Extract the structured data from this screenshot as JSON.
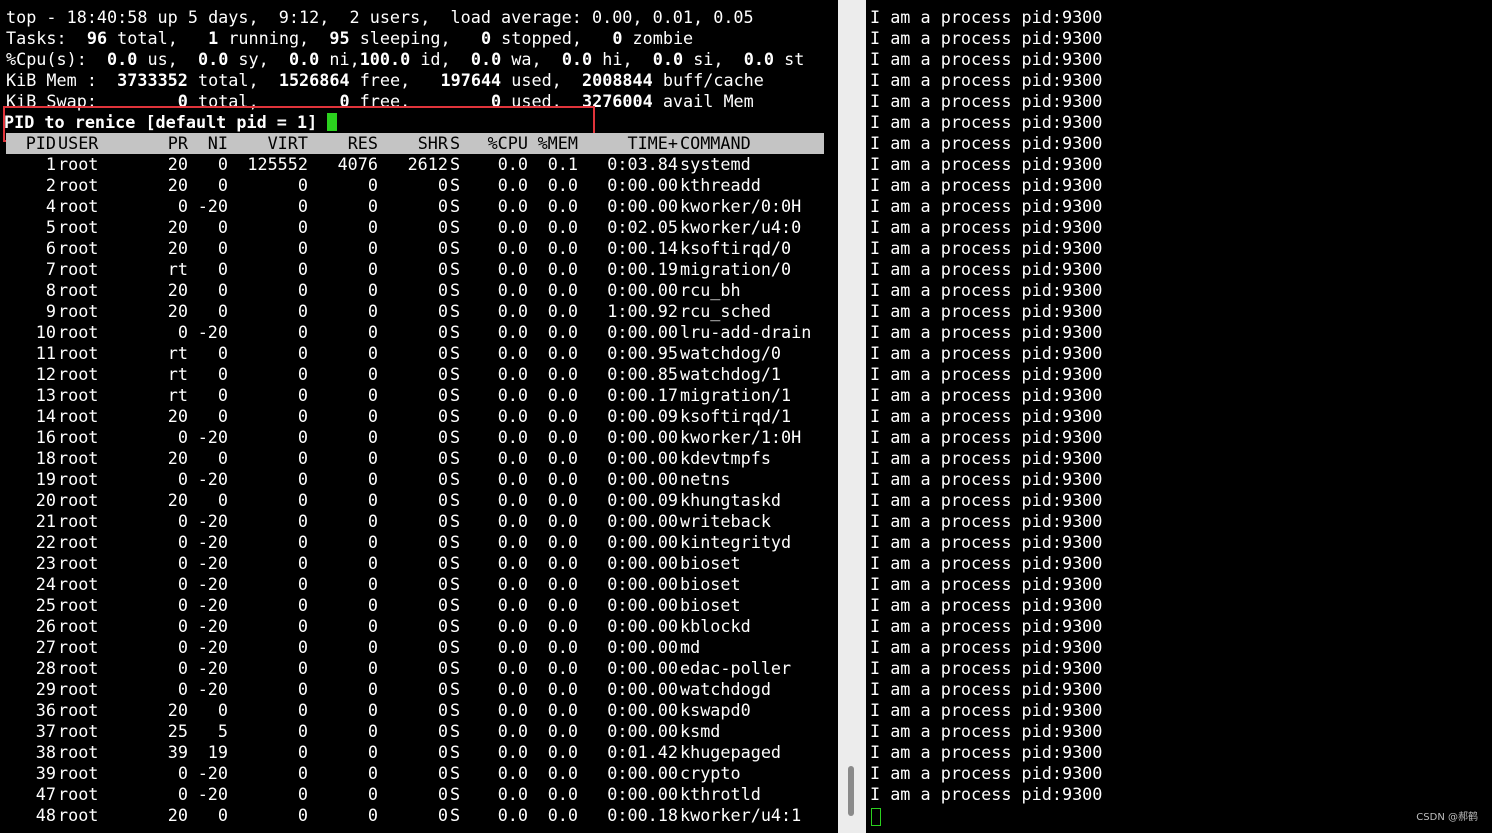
{
  "top_summary": {
    "line1": "top - 18:40:58 up 5 days,  9:12,  2 users,  load average: 0.00, 0.01, 0.05",
    "tasks": {
      "prefix": "Tasks:",
      "total": "96",
      "total_l": "total,",
      "running": "1",
      "running_l": "running,",
      "sleeping": "95",
      "sleeping_l": "sleeping,",
      "stopped": "0",
      "stopped_l": "stopped,",
      "zombie": "0",
      "zombie_l": "zombie"
    },
    "cpu": {
      "prefix": "%Cpu(s):",
      "us": "0.0",
      "us_l": "us,",
      "sy": "0.0",
      "sy_l": "sy,",
      "ni": "0.0",
      "ni_l": "ni,",
      "id": "100.0",
      "id_l": "id,",
      "wa": "0.0",
      "wa_l": "wa,",
      "hi": "0.0",
      "hi_l": "hi,",
      "si": "0.0",
      "si_l": "si,",
      "st": "0.0",
      "st_l": "st"
    },
    "mem": {
      "prefix": "KiB Mem :",
      "total": "3733352",
      "total_l": "total,",
      "free": "1526864",
      "free_l": "free,",
      "used": "197644",
      "used_l": "used,",
      "buff": "2008844",
      "buff_l": "buff/cache"
    },
    "swap": {
      "prefix": "KiB Swap:",
      "total": "0",
      "total_l": "total,",
      "free": "0",
      "free_l": "free.",
      "used": "0",
      "used_l": "used.",
      "avail": "3276004",
      "avail_l": "avail Mem"
    }
  },
  "prompt": "PID to renice [default pid = 1]",
  "columns": [
    "PID",
    "USER",
    "PR",
    "NI",
    "VIRT",
    "RES",
    "SHR",
    "S",
    "%CPU",
    "%MEM",
    "TIME+",
    "COMMAND"
  ],
  "processes": [
    [
      "1",
      "root",
      "20",
      "0",
      "125552",
      "4076",
      "2612",
      "S",
      "0.0",
      "0.1",
      "0:03.84",
      "systemd"
    ],
    [
      "2",
      "root",
      "20",
      "0",
      "0",
      "0",
      "0",
      "S",
      "0.0",
      "0.0",
      "0:00.00",
      "kthreadd"
    ],
    [
      "4",
      "root",
      "0",
      "-20",
      "0",
      "0",
      "0",
      "S",
      "0.0",
      "0.0",
      "0:00.00",
      "kworker/0:0H"
    ],
    [
      "5",
      "root",
      "20",
      "0",
      "0",
      "0",
      "0",
      "S",
      "0.0",
      "0.0",
      "0:02.05",
      "kworker/u4:0"
    ],
    [
      "6",
      "root",
      "20",
      "0",
      "0",
      "0",
      "0",
      "S",
      "0.0",
      "0.0",
      "0:00.14",
      "ksoftirqd/0"
    ],
    [
      "7",
      "root",
      "rt",
      "0",
      "0",
      "0",
      "0",
      "S",
      "0.0",
      "0.0",
      "0:00.19",
      "migration/0"
    ],
    [
      "8",
      "root",
      "20",
      "0",
      "0",
      "0",
      "0",
      "S",
      "0.0",
      "0.0",
      "0:00.00",
      "rcu_bh"
    ],
    [
      "9",
      "root",
      "20",
      "0",
      "0",
      "0",
      "0",
      "S",
      "0.0",
      "0.0",
      "1:00.92",
      "rcu_sched"
    ],
    [
      "10",
      "root",
      "0",
      "-20",
      "0",
      "0",
      "0",
      "S",
      "0.0",
      "0.0",
      "0:00.00",
      "lru-add-drain"
    ],
    [
      "11",
      "root",
      "rt",
      "0",
      "0",
      "0",
      "0",
      "S",
      "0.0",
      "0.0",
      "0:00.95",
      "watchdog/0"
    ],
    [
      "12",
      "root",
      "rt",
      "0",
      "0",
      "0",
      "0",
      "S",
      "0.0",
      "0.0",
      "0:00.85",
      "watchdog/1"
    ],
    [
      "13",
      "root",
      "rt",
      "0",
      "0",
      "0",
      "0",
      "S",
      "0.0",
      "0.0",
      "0:00.17",
      "migration/1"
    ],
    [
      "14",
      "root",
      "20",
      "0",
      "0",
      "0",
      "0",
      "S",
      "0.0",
      "0.0",
      "0:00.09",
      "ksoftirqd/1"
    ],
    [
      "16",
      "root",
      "0",
      "-20",
      "0",
      "0",
      "0",
      "S",
      "0.0",
      "0.0",
      "0:00.00",
      "kworker/1:0H"
    ],
    [
      "18",
      "root",
      "20",
      "0",
      "0",
      "0",
      "0",
      "S",
      "0.0",
      "0.0",
      "0:00.00",
      "kdevtmpfs"
    ],
    [
      "19",
      "root",
      "0",
      "-20",
      "0",
      "0",
      "0",
      "S",
      "0.0",
      "0.0",
      "0:00.00",
      "netns"
    ],
    [
      "20",
      "root",
      "20",
      "0",
      "0",
      "0",
      "0",
      "S",
      "0.0",
      "0.0",
      "0:00.09",
      "khungtaskd"
    ],
    [
      "21",
      "root",
      "0",
      "-20",
      "0",
      "0",
      "0",
      "S",
      "0.0",
      "0.0",
      "0:00.00",
      "writeback"
    ],
    [
      "22",
      "root",
      "0",
      "-20",
      "0",
      "0",
      "0",
      "S",
      "0.0",
      "0.0",
      "0:00.00",
      "kintegrityd"
    ],
    [
      "23",
      "root",
      "0",
      "-20",
      "0",
      "0",
      "0",
      "S",
      "0.0",
      "0.0",
      "0:00.00",
      "bioset"
    ],
    [
      "24",
      "root",
      "0",
      "-20",
      "0",
      "0",
      "0",
      "S",
      "0.0",
      "0.0",
      "0:00.00",
      "bioset"
    ],
    [
      "25",
      "root",
      "0",
      "-20",
      "0",
      "0",
      "0",
      "S",
      "0.0",
      "0.0",
      "0:00.00",
      "bioset"
    ],
    [
      "26",
      "root",
      "0",
      "-20",
      "0",
      "0",
      "0",
      "S",
      "0.0",
      "0.0",
      "0:00.00",
      "kblockd"
    ],
    [
      "27",
      "root",
      "0",
      "-20",
      "0",
      "0",
      "0",
      "S",
      "0.0",
      "0.0",
      "0:00.00",
      "md"
    ],
    [
      "28",
      "root",
      "0",
      "-20",
      "0",
      "0",
      "0",
      "S",
      "0.0",
      "0.0",
      "0:00.00",
      "edac-poller"
    ],
    [
      "29",
      "root",
      "0",
      "-20",
      "0",
      "0",
      "0",
      "S",
      "0.0",
      "0.0",
      "0:00.00",
      "watchdogd"
    ],
    [
      "36",
      "root",
      "20",
      "0",
      "0",
      "0",
      "0",
      "S",
      "0.0",
      "0.0",
      "0:00.00",
      "kswapd0"
    ],
    [
      "37",
      "root",
      "25",
      "5",
      "0",
      "0",
      "0",
      "S",
      "0.0",
      "0.0",
      "0:00.00",
      "ksmd"
    ],
    [
      "38",
      "root",
      "39",
      "19",
      "0",
      "0",
      "0",
      "S",
      "0.0",
      "0.0",
      "0:01.42",
      "khugepaged"
    ],
    [
      "39",
      "root",
      "0",
      "-20",
      "0",
      "0",
      "0",
      "S",
      "0.0",
      "0.0",
      "0:00.00",
      "crypto"
    ],
    [
      "47",
      "root",
      "0",
      "-20",
      "0",
      "0",
      "0",
      "S",
      "0.0",
      "0.0",
      "0:00.00",
      "kthrotld"
    ],
    [
      "48",
      "root",
      "20",
      "0",
      "0",
      "0",
      "0",
      "S",
      "0.0",
      "0.0",
      "0:00.18",
      "kworker/u4:1"
    ]
  ],
  "right_output": [
    "I am a process pid:9300",
    "I am a process pid:9300",
    "I am a process pid:9300",
    "I am a process pid:9300",
    "I am a process pid:9300",
    "I am a process pid:9300",
    "I am a process pid:9300",
    "I am a process pid:9300",
    "I am a process pid:9300",
    "I am a process pid:9300",
    "I am a process pid:9300",
    "I am a process pid:9300",
    "I am a process pid:9300",
    "I am a process pid:9300",
    "I am a process pid:9300",
    "I am a process pid:9300",
    "I am a process pid:9300",
    "I am a process pid:9300",
    "I am a process pid:9300",
    "I am a process pid:9300",
    "I am a process pid:9300",
    "I am a process pid:9300",
    "I am a process pid:9300",
    "I am a process pid:9300",
    "I am a process pid:9300",
    "I am a process pid:9300",
    "I am a process pid:9300",
    "I am a process pid:9300",
    "I am a process pid:9300",
    "I am a process pid:9300",
    "I am a process pid:9300",
    "I am a process pid:9300",
    "I am a process pid:9300",
    "I am a process pid:9300",
    "I am a process pid:9300",
    "I am a process pid:9300",
    "I am a process pid:9300",
    "I am a process pid:9300"
  ],
  "colors": {
    "highlight_box": "#e0343b",
    "cursor": "#2bd11e",
    "header_bg": "#c4c4c4"
  },
  "watermark": "CSDN @郝鹤"
}
